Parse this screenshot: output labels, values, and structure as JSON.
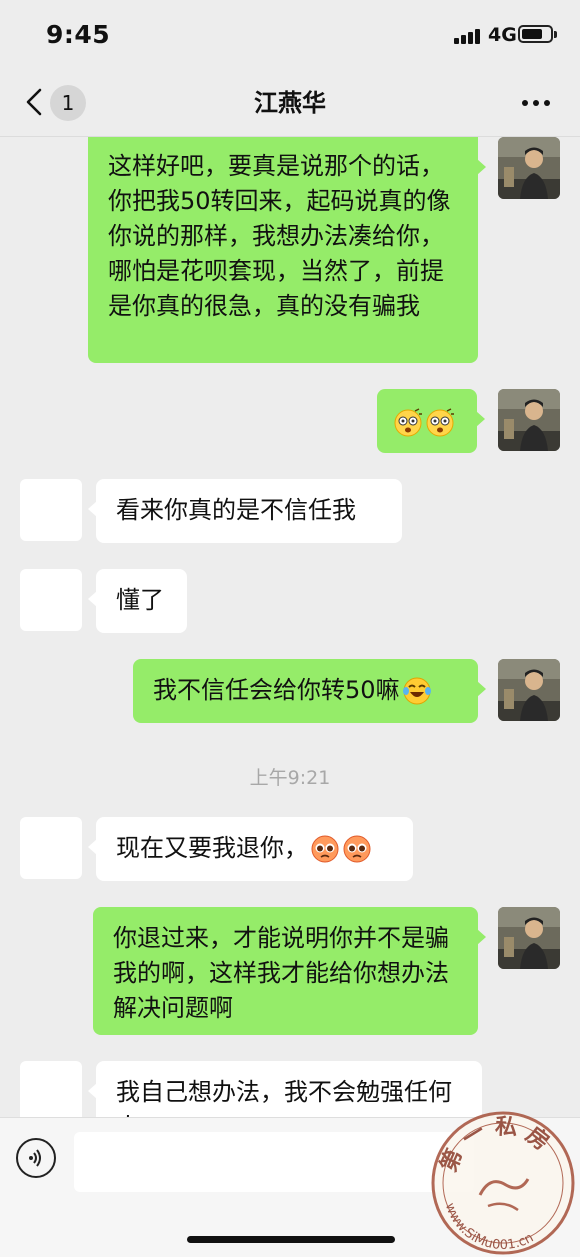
{
  "status": {
    "time": "9:45",
    "network": "4G"
  },
  "header": {
    "title": "江燕华",
    "unread": "1"
  },
  "messages": [
    {
      "side": "out",
      "text": "这样好吧，要真是说那个的话，你把我50转回来，起码说真的像你说的那样，我想办法凑给你，哪怕是花呗套现，当然了，前提是你真的很急，真的没有骗我"
    },
    {
      "side": "out",
      "emoji": [
        "dizzy-face-emoji",
        "dizzy-face-emoji"
      ]
    },
    {
      "side": "in",
      "text": "看来你真的是不信任我"
    },
    {
      "side": "in",
      "text": "懂了"
    },
    {
      "side": "out",
      "text": "我不信任会给你转50嘛",
      "emoji": [
        "laughing-tears-emoji"
      ]
    },
    {
      "side": "in",
      "text": "现在又要我退你，",
      "emoji": [
        "pleading-face-emoji",
        "pleading-face-emoji"
      ]
    },
    {
      "side": "out",
      "text": "你退过来，才能说明你并不是骗我的啊，这样我才能给你想办法解决问题啊"
    },
    {
      "side": "in",
      "text": "我自己想办法，我不会勉强任何人"
    }
  ],
  "timestamp": "上午9:21",
  "input": {
    "placeholder": ""
  },
  "watermark": {
    "text": "第一私房",
    "url": "www.SiMu001.cn"
  },
  "colors": {
    "outgoing": "#95ec69",
    "incoming": "#ffffff",
    "background": "#ededed"
  }
}
